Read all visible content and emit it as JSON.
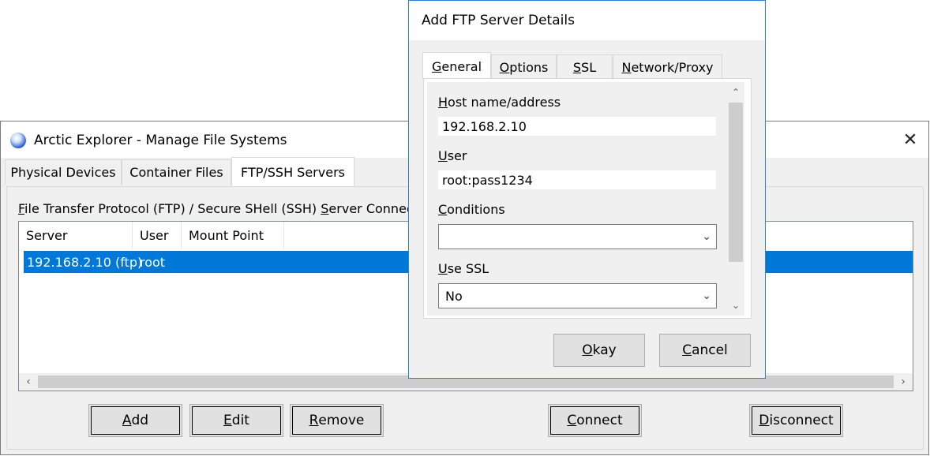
{
  "main_window": {
    "title": "Arctic Explorer - Manage File Systems",
    "close_glyph": "✕",
    "tabs": [
      {
        "label": "Physical Devices",
        "active": false
      },
      {
        "label": "Container Files",
        "active": false
      },
      {
        "label": "FTP/SSH Servers",
        "active": true
      }
    ],
    "group_label_parts": [
      "F",
      "ile Transfer Protocol (FTP) / Secure SHell (SSH) ",
      "S",
      "erver Connections"
    ],
    "list": {
      "columns": [
        "Server",
        "User",
        "Mount Point"
      ],
      "rows": [
        {
          "server": "192.168.2.10 (ftp)",
          "user": "root",
          "mount_point": "",
          "selected": true
        }
      ]
    },
    "buttons": {
      "add": [
        "A",
        "dd"
      ],
      "edit": [
        "E",
        "dit"
      ],
      "remove": [
        "R",
        "emove"
      ],
      "connect": [
        "C",
        "onnect"
      ],
      "disconnect": [
        "D",
        "isconnect"
      ]
    },
    "icons": {
      "app": "arctic-explorer-icon",
      "scroll_left": "‹",
      "scroll_right": "›"
    }
  },
  "dialog": {
    "title": "Add FTP Server Details",
    "tabs": [
      {
        "label_parts": [
          "G",
          "eneral"
        ],
        "active": true
      },
      {
        "label_parts": [
          "O",
          "ptions"
        ],
        "active": false
      },
      {
        "label_parts": [
          "S",
          "SL"
        ],
        "active": false
      },
      {
        "label_parts": [
          "N",
          "etwork/Proxy"
        ],
        "active": false
      }
    ],
    "fields": {
      "host": {
        "label_parts": [
          "H",
          "ost name/address"
        ],
        "value": "192.168.2.10"
      },
      "user": {
        "label_parts": [
          "U",
          "ser"
        ],
        "value": "root:pass1234"
      },
      "conditions": {
        "label_parts": [
          "C",
          "onditions"
        ],
        "value": ""
      },
      "use_ssl": {
        "label_parts": [
          "U",
          "se SSL"
        ],
        "value": "No"
      }
    },
    "buttons": {
      "okay": [
        "O",
        "kay"
      ],
      "cancel": [
        "C",
        "ancel"
      ]
    },
    "icons": {
      "scroll_up": "⌃",
      "scroll_down": "⌄",
      "combo_arrow": "⌄"
    }
  }
}
